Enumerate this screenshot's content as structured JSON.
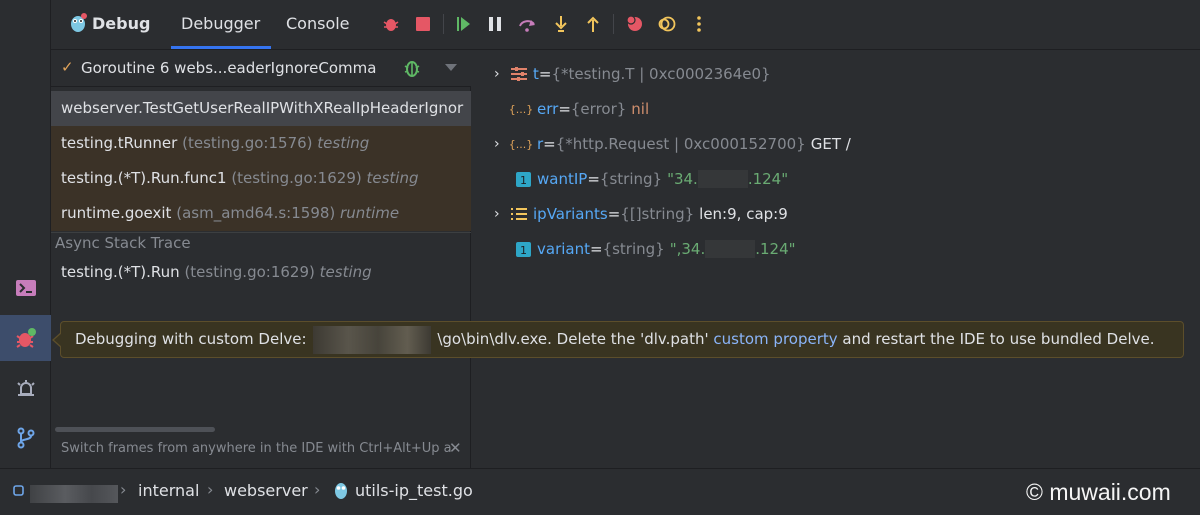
{
  "header": {
    "title": "Debug",
    "tabs": [
      {
        "label": "Debugger"
      },
      {
        "label": "Console"
      }
    ]
  },
  "goroutine": {
    "label": "Goroutine 6 webs...eaderIgnoreComma"
  },
  "frames": [
    {
      "fn": "webserver.TestGetUserRealIPWithXRealIpHeaderIgnor",
      "loc": "",
      "pkg": ""
    },
    {
      "fn": "testing.tRunner",
      "loc": "(testing.go:1576)",
      "pkg": "testing"
    },
    {
      "fn": "testing.(*T).Run.func1",
      "loc": "(testing.go:1629)",
      "pkg": "testing"
    },
    {
      "fn": "runtime.goexit",
      "loc": "(asm_amd64.s:1598)",
      "pkg": "runtime"
    }
  ],
  "async": {
    "label": "Async Stack Trace",
    "frame": {
      "fn": "testing.(*T).Run",
      "loc": "(testing.go:1629)",
      "pkg": "testing"
    }
  },
  "frames_hint": "Switch frames from anywhere in the IDE with Ctrl+Alt+Up a",
  "variables": [
    {
      "name": "t",
      "eq": " = ",
      "type": "{*testing.T | 0xc0002364e0}",
      "value": ""
    },
    {
      "name": "err",
      "eq": " = ",
      "type": "{error}",
      "value": "nil"
    },
    {
      "name": "r",
      "eq": " = ",
      "type": "{*http.Request | 0xc000152700}",
      "value": "GET /"
    },
    {
      "name": "wantIP",
      "eq": " = ",
      "type": "{string}",
      "value_pre": "\"34.",
      "value_post": ".124\""
    },
    {
      "name": "ipVariants",
      "eq": " = ",
      "type": "{[]string}",
      "value": "len:9, cap:9"
    },
    {
      "name": "variant",
      "eq": " = ",
      "type": "{string}",
      "value_pre": "\",34.",
      "value_post": ".124\""
    }
  ],
  "tooltip": {
    "prefix": "Debugging with custom Delve:",
    "path_suffix": "\\go\\bin\\dlv.exe. Delete the 'dlv.path'",
    "link": "custom property",
    "suffix": "and restart the IDE to use bundled Delve."
  },
  "breadcrumbs": [
    "internal",
    "webserver",
    "utils-ip_test.go"
  ],
  "watermark": "© muwaii.com",
  "colors": {
    "accent": "#3574f0",
    "variable": "#56a8f5",
    "string": "#6aab73",
    "keyword": "#cf8e6d"
  }
}
